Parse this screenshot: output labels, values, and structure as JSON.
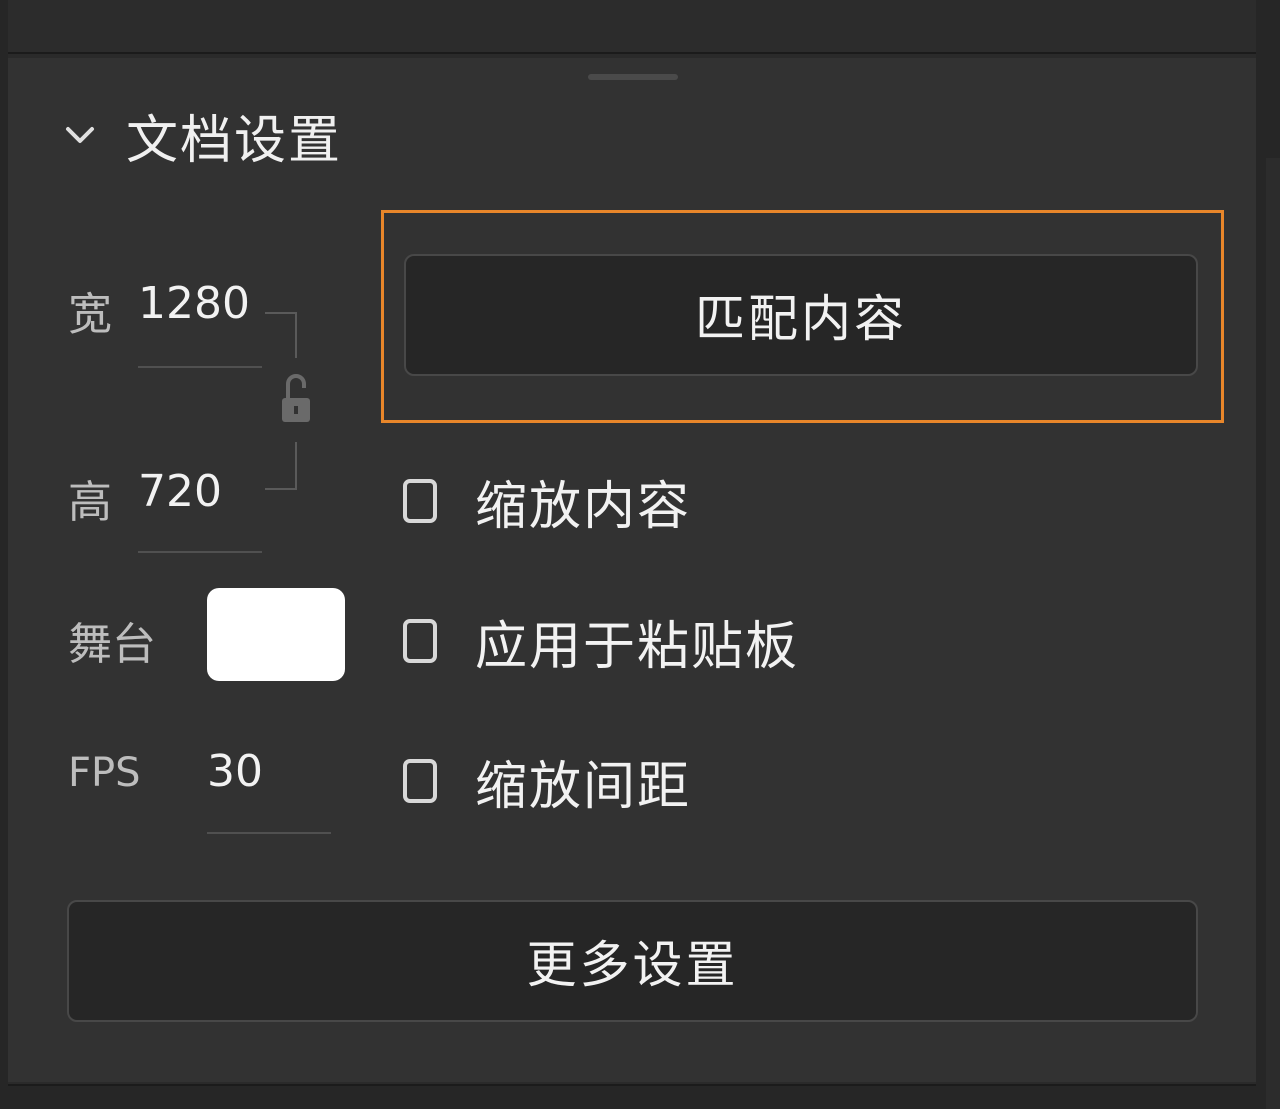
{
  "section": {
    "title": "文档设置",
    "chevron_icon": "chevron-down-icon"
  },
  "document": {
    "width_label": "宽",
    "width_value": "1280",
    "height_label": "高",
    "height_value": "720",
    "lock_icon": "unlock-icon",
    "stage_label": "舞台",
    "stage_color": "#ffffff",
    "fps_label": "FPS",
    "fps_value": "30"
  },
  "buttons": {
    "match_content": "匹配内容",
    "more_settings": "更多设置"
  },
  "options": [
    {
      "label": "缩放内容",
      "checked": false
    },
    {
      "label": "应用于粘贴板",
      "checked": false
    },
    {
      "label": "缩放间距",
      "checked": false
    }
  ],
  "colors": {
    "highlight": "#e8862a",
    "panel_bg": "#323232",
    "button_bg": "#262626"
  }
}
